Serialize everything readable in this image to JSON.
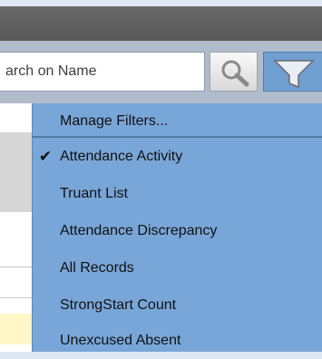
{
  "search": {
    "text": "arch on Name"
  },
  "filter_menu": {
    "items": [
      {
        "label": "Manage Filters...",
        "checked": false
      },
      {
        "label": "Attendance Activity",
        "checked": true
      },
      {
        "label": "Truant List",
        "checked": false
      },
      {
        "label": "Attendance Discrepancy",
        "checked": false
      },
      {
        "label": "All Records",
        "checked": false
      },
      {
        "label": "StrongStart Count",
        "checked": false
      },
      {
        "label": "Unexcused Absent",
        "checked": false
      }
    ],
    "check_glyph": "✔"
  },
  "colors": {
    "menu_bg": "#79a6d8",
    "filter_button": "#6f9ed1",
    "toolbar": "#5f5f5f"
  }
}
